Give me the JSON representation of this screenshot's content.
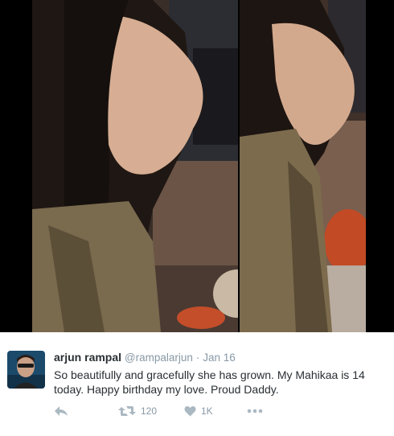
{
  "media": {
    "photos": [
      "photo-left",
      "photo-right"
    ],
    "background": "#000000"
  },
  "tweet": {
    "display_name": "arjun rampal",
    "handle": "@rampalarjun",
    "separator": "·",
    "date": "Jan 16",
    "text": "So beautifully and gracefully she has grown. My Mahikaa is 14 today. Happy birthday my love. Proud Daddy.",
    "retweet_count": "120",
    "like_count": "1K"
  },
  "icons": {
    "reply": "reply-icon",
    "retweet": "retweet-icon",
    "like": "heart-icon",
    "more": "more-icon"
  },
  "colors": {
    "name": "#292f33",
    "muted": "#8899a6",
    "icon": "#aab8c2"
  }
}
